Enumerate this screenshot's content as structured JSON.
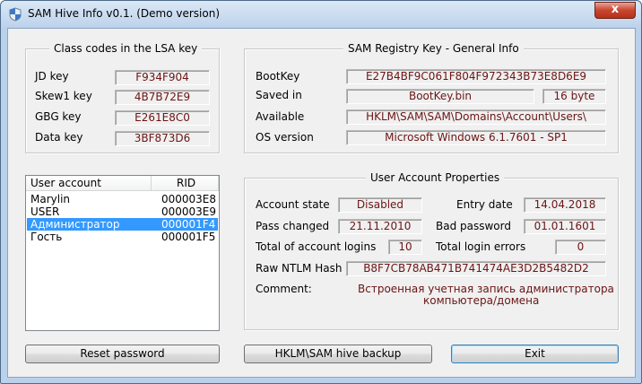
{
  "window": {
    "title": "SAM Hive Info v0.1. (Demo version)",
    "close_glyph": "x"
  },
  "lsa": {
    "legend": "Class codes in the LSA key",
    "rows": [
      {
        "label": "JD key",
        "value": "F934F904"
      },
      {
        "label": "Skew1 key",
        "value": "4B7B72E9"
      },
      {
        "label": "GBG key",
        "value": "E261E8C0"
      },
      {
        "label": "Data key",
        "value": "3BF873D6"
      }
    ]
  },
  "general": {
    "legend": "SAM Registry Key - General Info",
    "bootkey_label": "BootKey",
    "bootkey": "E27B4BF9C061F804F972343B73E8D6E9",
    "saved_label": "Saved in",
    "saved_file": "BootKey.bin",
    "saved_size": "16 byte",
    "available_label": "Available",
    "available": "HKLM\\SAM\\SAM\\Domains\\Account\\Users\\",
    "os_label": "OS version",
    "os": "Microsoft Windows 6.1.7601 - SP1"
  },
  "accounts": {
    "columns": [
      "User account",
      "RID"
    ],
    "rows": [
      {
        "name": "Marylin",
        "rid": "000003E8",
        "selected": false
      },
      {
        "name": "USER",
        "rid": "000003E9",
        "selected": false
      },
      {
        "name": "Администратор",
        "rid": "000001F4",
        "selected": true
      },
      {
        "name": "Гость",
        "rid": "000001F5",
        "selected": false
      }
    ]
  },
  "props": {
    "legend": "User Account Properties",
    "state_label": "Account state",
    "state": "Disabled",
    "entry_label": "Entry date",
    "entry": "14.04.2018",
    "pwchanged_label": "Pass changed",
    "pwchanged": "21.11.2010",
    "badpw_label": "Bad password",
    "badpw": "01.01.1601",
    "logins_label": "Total of account logins",
    "logins": "10",
    "errors_label": "Total login errors",
    "errors": "0",
    "ntlm_label": "Raw NTLM Hash",
    "ntlm": "B8F7CB78AB471B741474AE3D2B5482D2",
    "comment_label": "Comment:",
    "comment_line1": "Встроенная учетная запись администратора",
    "comment_line2": "компьютера/домена"
  },
  "buttons": {
    "reset": "Reset password",
    "backup": "HKLM\\SAM hive backup",
    "exit": "Exit"
  },
  "colors": {
    "value_text": "#6b1414",
    "selection": "#3399ff",
    "frame": "#b9d1ea"
  }
}
